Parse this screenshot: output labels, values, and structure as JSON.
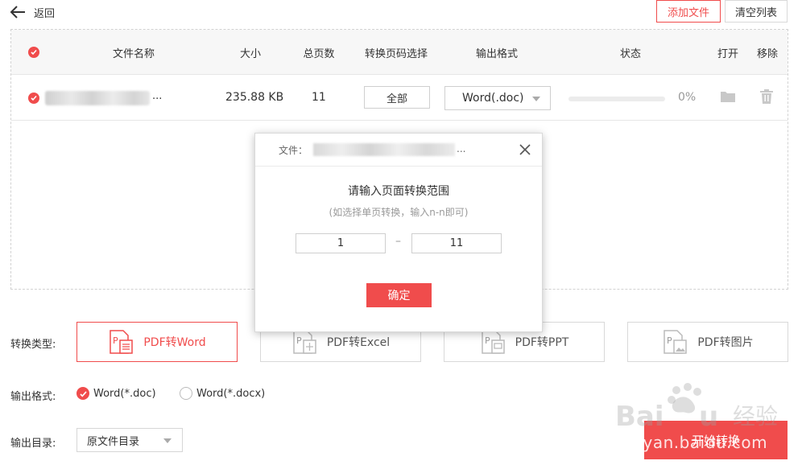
{
  "header": {
    "back_label": "返回",
    "add_files_label": "添加文件",
    "clear_list_label": "清空列表"
  },
  "table": {
    "columns": {
      "name": "文件名称",
      "size": "大小",
      "pages": "总页数",
      "page_select": "转换页码选择",
      "output_format": "输出格式",
      "status": "状态",
      "open": "打开",
      "remove": "移除"
    },
    "rows": [
      {
        "name_suffix": "...",
        "size": "235.88 KB",
        "pages": "11",
        "page_range": "全部",
        "format": "Word(.doc)",
        "progress_text": "0%",
        "progress": 0
      }
    ]
  },
  "modal": {
    "file_label": "文件：",
    "file_suffix": "...",
    "title": "请输入页面转换范围",
    "hint": "(如选择单页转换，输入n-n即可)",
    "from_page": "1",
    "separator": "–",
    "to_page": "11",
    "confirm_label": "确定"
  },
  "conversion": {
    "type_label": "转换类型:",
    "types": [
      {
        "label": "PDF转Word",
        "icon": "pdf-to-word-icon",
        "active": true
      },
      {
        "label": "PDF转Excel",
        "icon": "pdf-to-excel-icon",
        "active": false
      },
      {
        "label": "PDF转PPT",
        "icon": "pdf-to-ppt-icon",
        "active": false
      },
      {
        "label": "PDF转图片",
        "icon": "pdf-to-image-icon",
        "active": false
      }
    ]
  },
  "output_format": {
    "label": "输出格式:",
    "options": [
      {
        "label": "Word(*.doc)",
        "selected": true
      },
      {
        "label": "Word(*.docx)",
        "selected": false
      }
    ]
  },
  "output_dir": {
    "label": "输出目录:",
    "value": "原文件目录"
  },
  "start_label": "开始转换",
  "watermark": {
    "text": "jingyan.baidu.com"
  },
  "colors": {
    "accent": "#f04c4c",
    "border": "#d9d9d9",
    "header_bg": "#f7f7f7"
  }
}
